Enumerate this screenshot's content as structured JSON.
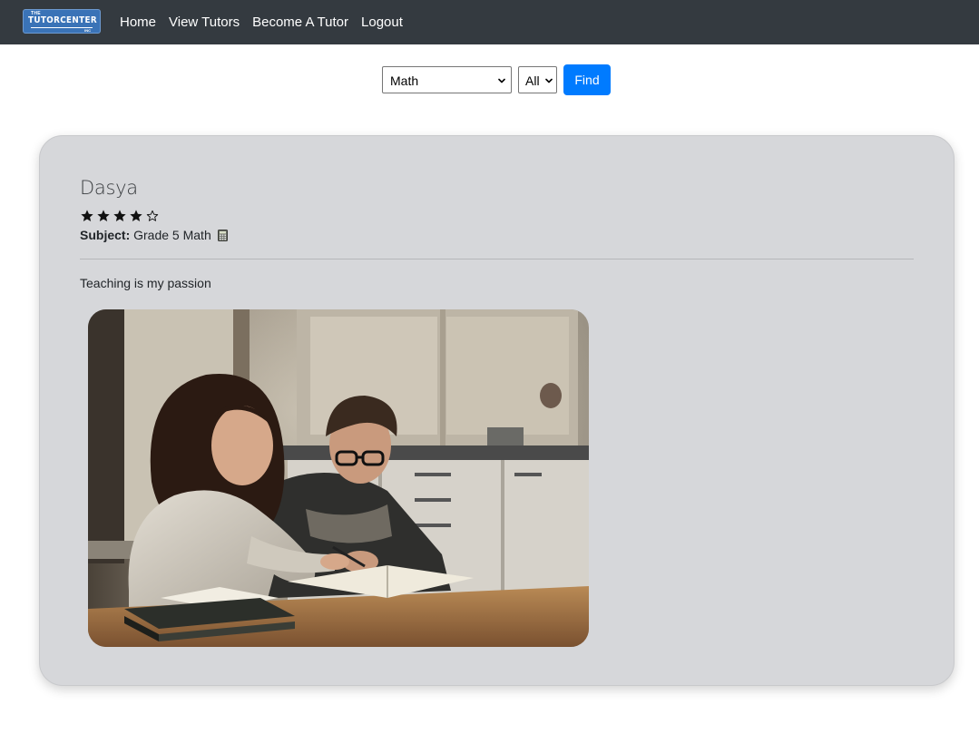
{
  "brand": {
    "top_text": "THE",
    "name": "TUTORCENTER",
    "bottom_text": "INC"
  },
  "nav": {
    "links": [
      "Home",
      "View Tutors",
      "Become A Tutor",
      "Logout"
    ]
  },
  "search": {
    "subject_value": "Math",
    "grade_value": "All",
    "find_label": "Find"
  },
  "tutor": {
    "name": "Dasya",
    "rating": 4,
    "rating_max": 5,
    "subject_label": "Subject:",
    "subject_value": "Grade 5 Math",
    "bio": "Teaching is my passion",
    "photo_icon": "tutor-photo-image"
  },
  "colors": {
    "navbar": "#343a40",
    "accent": "#007bff",
    "card_bg": "#d6d7da",
    "brand_bg": "#3a73b7"
  },
  "icons": {
    "star_filled": "star-filled-icon",
    "star_empty": "star-empty-icon",
    "subject": "calculator-icon",
    "dropdown": "chevron-down-icon"
  }
}
